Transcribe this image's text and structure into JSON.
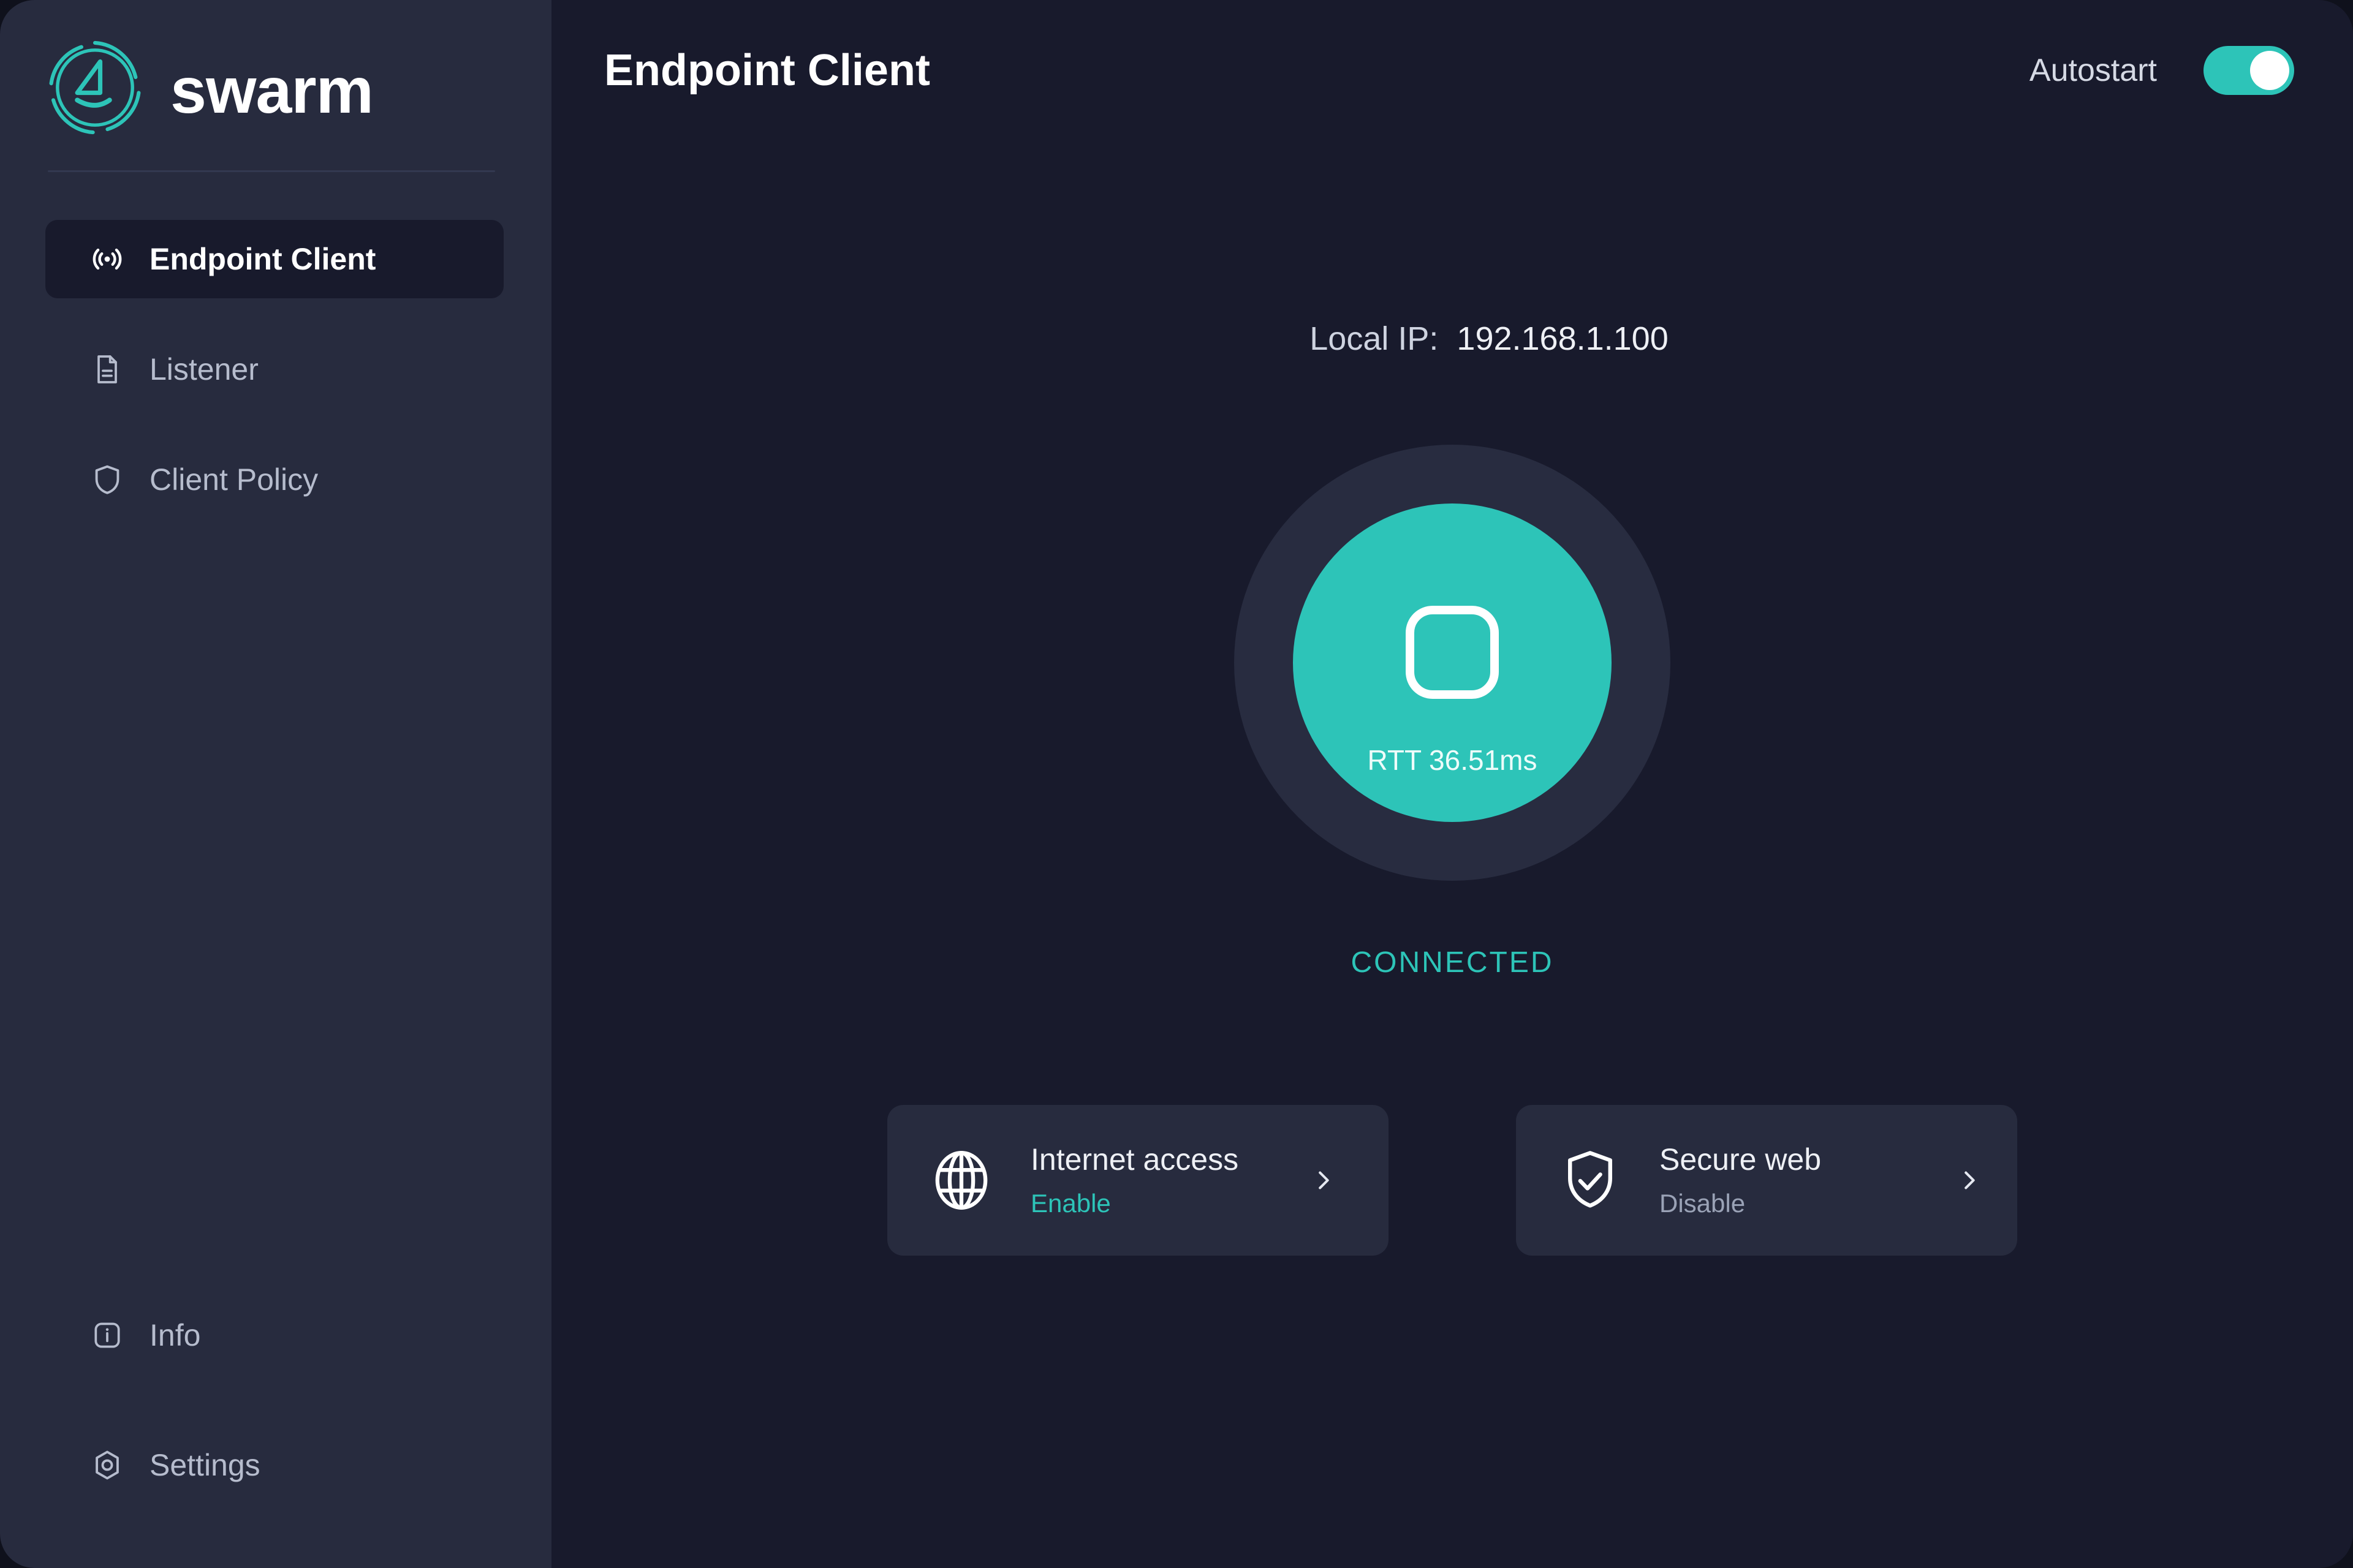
{
  "app": {
    "brand_name": "swarm",
    "logo_icon": "swarm-sail-circle-logo"
  },
  "sidebar": {
    "items": [
      {
        "label": "Endpoint Client",
        "icon": "broadcast-icon",
        "active": true
      },
      {
        "label": "Listener",
        "icon": "document-icon",
        "active": false
      },
      {
        "label": "Client Policy",
        "icon": "shield-icon",
        "active": false
      }
    ],
    "bottom_items": [
      {
        "label": "Info",
        "icon": "info-icon"
      },
      {
        "label": "Settings",
        "icon": "gear-hexagon-icon"
      }
    ]
  },
  "header": {
    "title": "Endpoint Client",
    "autostart_label": "Autostart",
    "autostart_on": true
  },
  "main": {
    "local_ip_label": "Local IP:",
    "local_ip_value": "192.168.1.100",
    "dial": {
      "icon": "stop-square-icon",
      "rtt_text": "RTT 36.51ms"
    },
    "status": "CONNECTED",
    "cards": [
      {
        "title": "Internet access",
        "subtitle": "Enable",
        "subtitle_accent": true,
        "icon": "globe-icon",
        "chevron": "chevron-right-icon"
      },
      {
        "title": "Secure web",
        "subtitle": "Disable",
        "subtitle_accent": false,
        "icon": "shield-check-icon",
        "chevron": "chevron-right-icon"
      }
    ]
  },
  "colors": {
    "accent_teal": "#2dc4b8",
    "sidebar_bg": "#272b3e",
    "main_bg": "#181a2c",
    "ring_bg": "#282c40",
    "text_primary": "#eef0f5",
    "text_muted": "#9aa2b6"
  }
}
